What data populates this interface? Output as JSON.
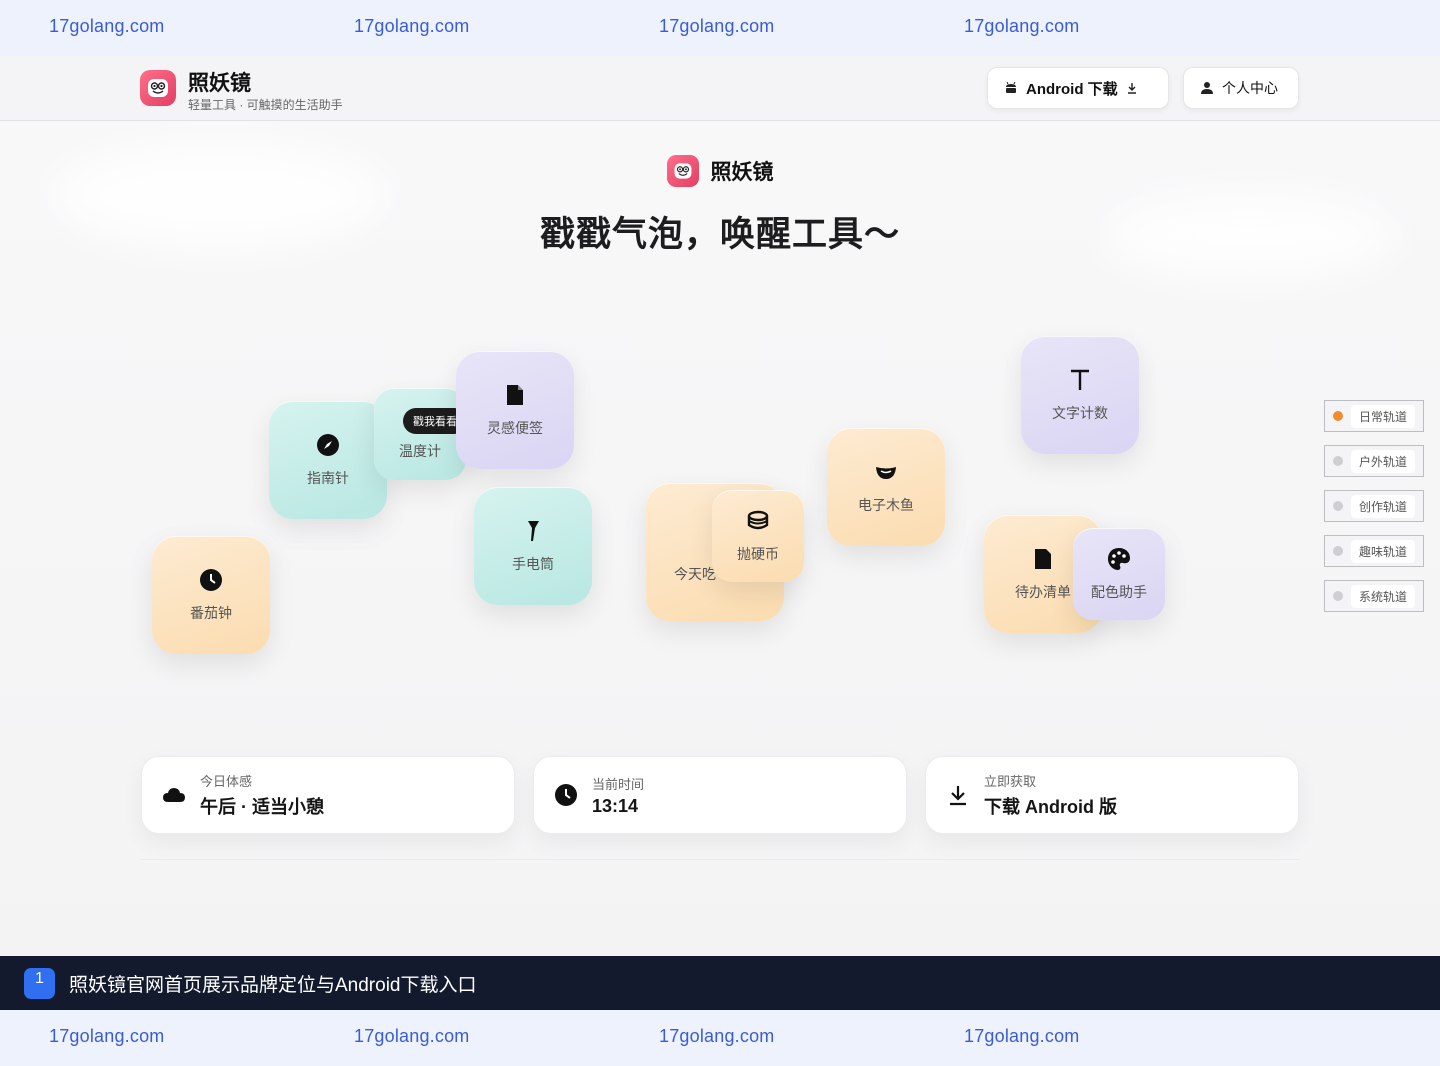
{
  "watermark": {
    "text": "17golang.com"
  },
  "header": {
    "app_name": "照妖镜",
    "tagline": "轻量工具 · 可触摸的生活助手",
    "android_button": "Android 下载",
    "profile_button": "个人中心"
  },
  "hero": {
    "name": "照妖镜",
    "title": "戳戳气泡，唤醒工具～"
  },
  "bubbles": {
    "compass": "指南针",
    "thermometer": "温度计",
    "thermometer_tip": "戳我看看",
    "notes": "灵感便签",
    "flashlight": "手电筒",
    "pomodoro": "番茄钟",
    "today": "今天吃",
    "coin": "抛硬币",
    "woodfish": "电子木鱼",
    "wordcount": "文字计数",
    "todo": "待办清单",
    "palette": "配色助手"
  },
  "rails": [
    {
      "label": "日常轨道",
      "active": true
    },
    {
      "label": "户外轨道",
      "active": false
    },
    {
      "label": "创作轨道",
      "active": false
    },
    {
      "label": "趣味轨道",
      "active": false
    },
    {
      "label": "系统轨道",
      "active": false
    }
  ],
  "cards": {
    "mood": {
      "label": "今日体感",
      "value": "午后 · 适当小憩"
    },
    "time": {
      "label": "当前时间",
      "value": "13:14"
    },
    "download": {
      "label": "立即获取",
      "value": "下载 Android 版"
    }
  },
  "caption": {
    "number": "1",
    "text": "照妖镜官网首页展示品牌定位与Android下载入口"
  },
  "colors": {
    "accent_blue": "#2f6ff0",
    "rail_active": "#f28b2c",
    "logo_pink": "#e23e63"
  }
}
